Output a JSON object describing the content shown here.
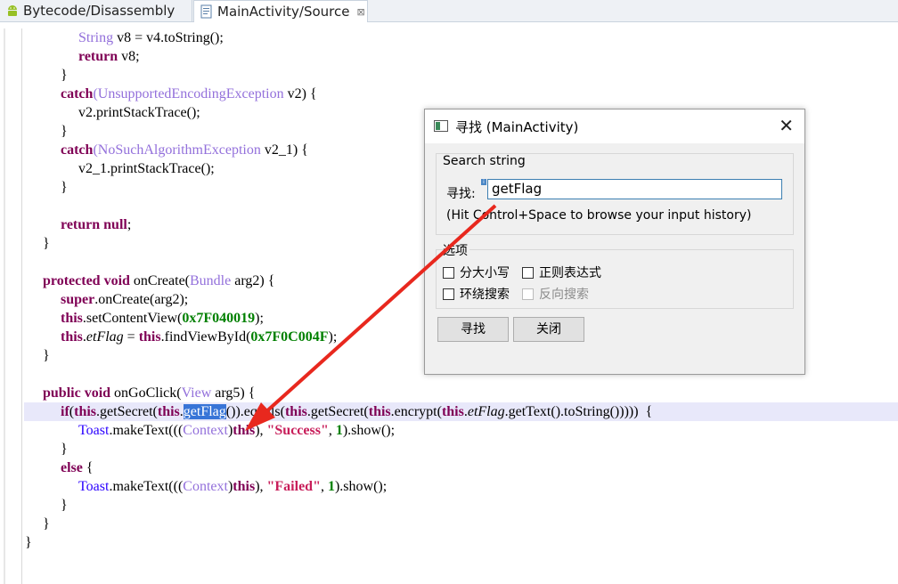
{
  "tabs": [
    {
      "label": "Bytecode/Disassembly",
      "icon": "android-icon"
    },
    {
      "label": "MainActivity/Source",
      "icon": "java-file-icon",
      "close": "⊠"
    }
  ],
  "code": {
    "l1": {
      "ty": "String",
      "rest": " v8 = v4.toString();"
    },
    "l2": {
      "kw": "return",
      "rest": " v8;"
    },
    "l3": "}",
    "l4": {
      "kw": "catch",
      "p": "(",
      "ty": "UnsupportedEncodingException",
      "rest": " v2) {"
    },
    "l5": "v2.printStackTrace();",
    "l6": "}",
    "l7": {
      "kw": "catch",
      "p": "(",
      "ty": "NoSuchAlgorithmException",
      "rest": " v2_1) {"
    },
    "l8": "v2_1.printStackTrace();",
    "l9": "}",
    "l10": {
      "kw": "return",
      "sp": " ",
      "kw2": "null",
      "rest": ";"
    },
    "l11": "}",
    "l12": {
      "kw": "protected void",
      "sp": " onCreate(",
      "ty": "Bundle",
      "rest": " arg2) {"
    },
    "l13": {
      "kw": "super",
      "rest": ".onCreate(arg2);"
    },
    "l14": {
      "kw": "this",
      "mid": ".setContentView(",
      "num": "0x7F040019",
      "rest": ");"
    },
    "l15": {
      "kw": "this",
      "dot": ".",
      "it": "etFlag",
      "eq": " = ",
      "kw2": "this",
      "mid": ".findViewById(",
      "num": "0x7F0C0",
      "num2": "04F",
      "rest": ");"
    },
    "l16": "}",
    "l17": {
      "kw": "public void",
      "sp": " onGoClick(",
      "ty": "View",
      "rest": " arg5) {"
    },
    "l18": {
      "kw": "if",
      "a": "(",
      "kw2": "this",
      "b": ".getSecret(",
      "kw3": "this",
      "c": ".",
      "sel": "getFlag",
      "d": "()).equals(",
      "kw4": "this",
      "e": ".getSecret(",
      "kw5": "this",
      "f": ".encrypt(",
      "kw6": "this",
      "g": ".",
      "it": "etFlag",
      "h": ".getText().toString()))))  {"
    },
    "l19": {
      "st": "Toast",
      "a": ".makeText(((",
      "ty": "Context",
      "b": ")",
      "kw": "this",
      "c": "), ",
      "str": "\"Success\"",
      "d": ", ",
      "num": "1",
      "e": ").show();"
    },
    "l20": "}",
    "l21": {
      "kw": "else",
      "rest": " {"
    },
    "l22": {
      "st": "Toast",
      "a": ".makeText(((",
      "ty": "Context",
      "b": ")",
      "kw": "this",
      "c": "), ",
      "str": "\"Failed\"",
      "d": ", ",
      "num": "1",
      "e": ").show();"
    },
    "l23": "}",
    "l24": "}",
    "l25": "}"
  },
  "dialog": {
    "title": "寻找 (MainActivity)",
    "close": "✕",
    "search_group": "Search string",
    "field_label": "寻找:",
    "input_value": "getFlag",
    "hint": "(Hit Control+Space to browse your input history)",
    "options_group": "选项",
    "opt_case": "分大小写",
    "opt_regex": "正则表达式",
    "opt_wrap": "环绕搜索",
    "opt_reverse": "反向搜索",
    "find_button": "寻找",
    "close_button": "关闭"
  },
  "colors": {
    "keyword": "#7f0055",
    "type": "#9370db",
    "number": "#008000",
    "string": "#c81e5a",
    "arrow": "#e8281e",
    "selection": "#3875d7"
  }
}
